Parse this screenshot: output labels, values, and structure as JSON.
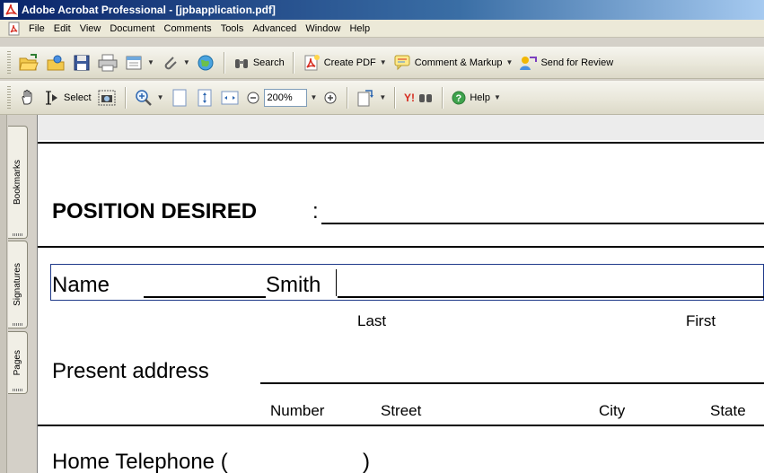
{
  "window": {
    "title": "Adobe Acrobat Professional - [jpbapplication.pdf]"
  },
  "menu": {
    "items": [
      "File",
      "Edit",
      "View",
      "Document",
      "Comments",
      "Tools",
      "Advanced",
      "Window",
      "Help"
    ]
  },
  "toolbar1": {
    "search_label": "Search",
    "create_pdf_label": "Create PDF",
    "comment_markup_label": "Comment & Markup",
    "send_review_label": "Send for Review"
  },
  "toolbar2": {
    "select_label": "Select",
    "zoom_value": "200%",
    "help_label": "Help"
  },
  "nav_tabs": [
    "Bookmarks",
    "Signatures",
    "Pages"
  ],
  "form": {
    "position_label": "POSITION DESIRED",
    "position_colon": ":",
    "name_label": "Name",
    "name_value": "Smith",
    "last_label": "Last",
    "first_label": "First",
    "present_address_label": "Present address",
    "number_label": "Number",
    "street_label": "Street",
    "city_label": "City",
    "state_label": "State",
    "home_telephone_label": "Home Telephone (",
    "home_telephone_close": ")"
  },
  "colors": {
    "title_bar": "#0a246a",
    "field_border": "#1f3a8a",
    "pdf_red": "#d62b1f"
  }
}
